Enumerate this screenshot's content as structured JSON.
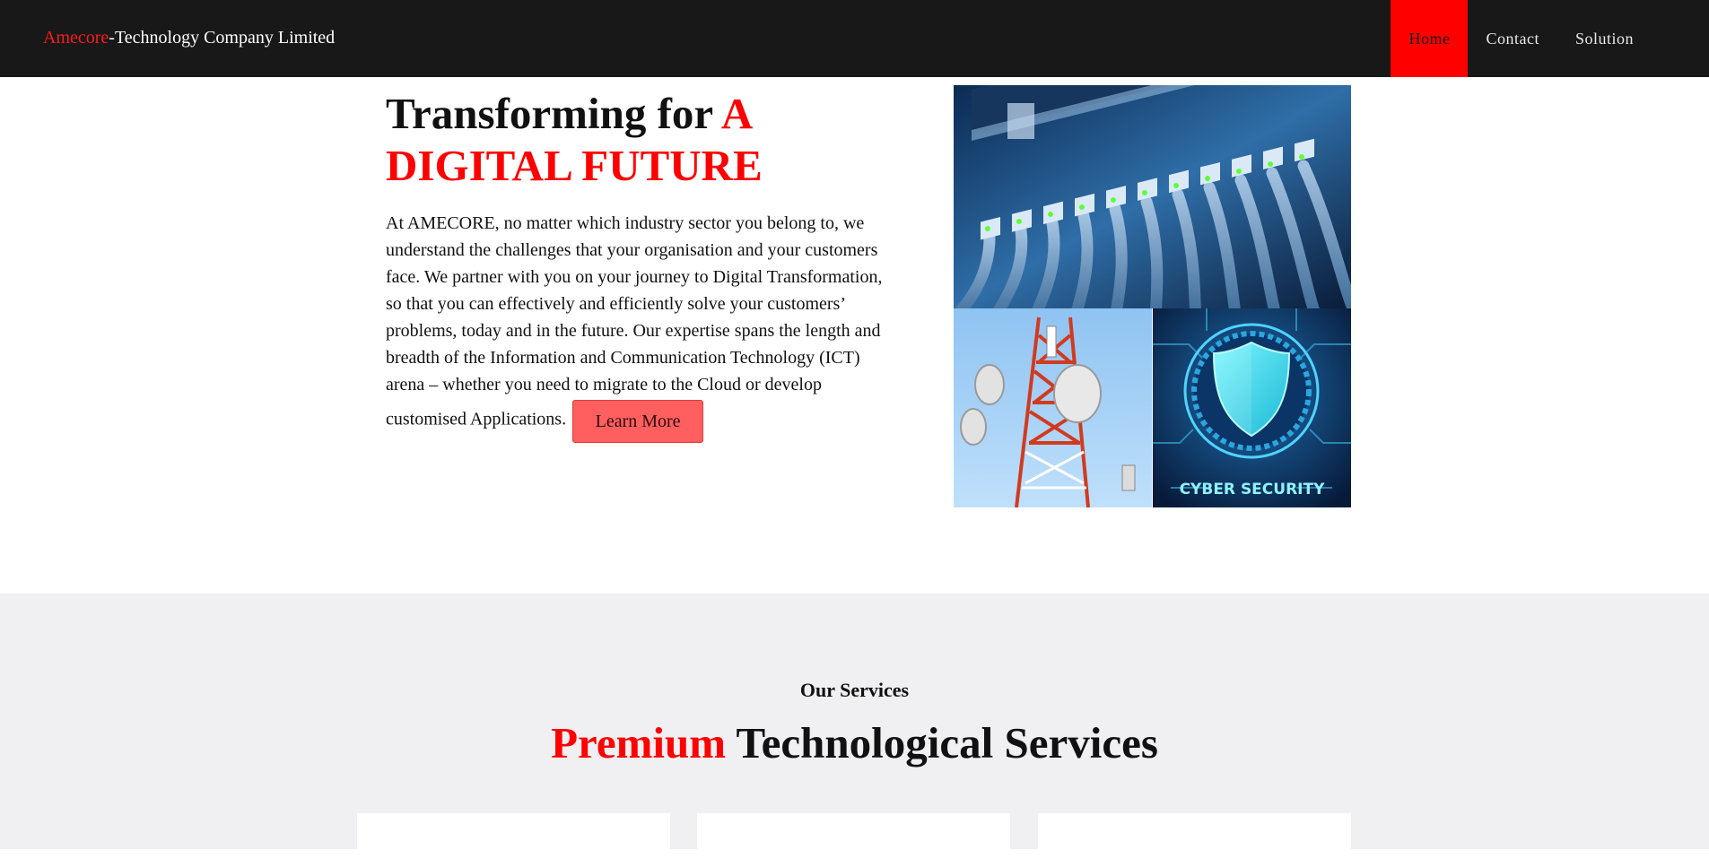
{
  "navbar": {
    "brand_accent": "Amecore",
    "brand_rest": "-Technology Company Limited",
    "links": [
      {
        "label": "Home",
        "active": true
      },
      {
        "label": "Contact",
        "active": false
      },
      {
        "label": "Solution",
        "active": false
      }
    ]
  },
  "hero": {
    "title_part1": "Transforming for ",
    "title_part2": "A DIGITAL FUTURE",
    "description": "At AMECORE, no matter which industry sector you belong to, we understand the challenges that your organisation and your customers face. We partner with you on your journey to Digital Transformation, so that you can effectively and efficiently solve your customers’ problems, today and in the future. Our expertise spans the length and breadth of the Information and Communication Technology (ICT) arena – whether you need to migrate to the Cloud or develop customised Applications.",
    "cta_label": "Learn More",
    "images": {
      "server": "network-cables-image",
      "tower": "telecom-tower-image",
      "cyber": "cyber-security-image",
      "cyber_label": "CYBER SECURITY"
    }
  },
  "services": {
    "kicker": "Our Services",
    "title_accent": "Premium",
    "title_rest": " Technological Services"
  },
  "colors": {
    "accent": "#ff0000",
    "navbar_bg": "#181818",
    "button_bg": "#ff5f5f",
    "services_bg": "#f0f0f2"
  }
}
